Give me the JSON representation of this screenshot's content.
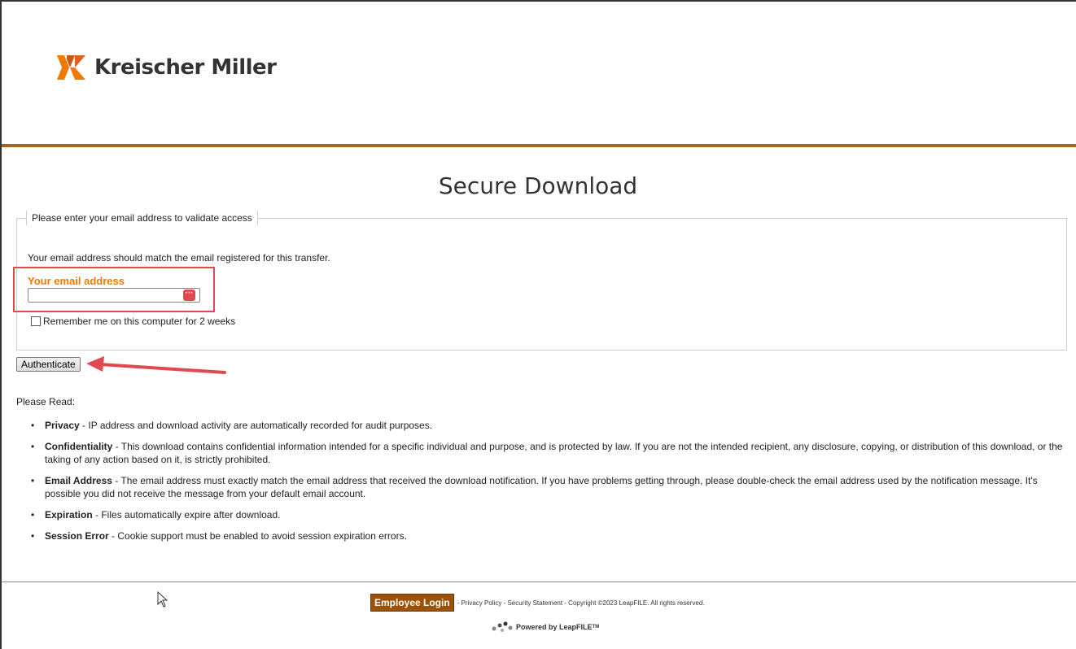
{
  "header": {
    "logo_text": "Kreischer Miller",
    "brand_color": "#a8641a"
  },
  "main": {
    "title": "Secure Download",
    "legend": "Please enter your email address to validate access",
    "intro": "Your email address should match the email registered for this transfer.",
    "email_label": "Your email address",
    "email_value": "",
    "email_placeholder": "",
    "password_manager_icon": "password-manager-icon",
    "remember_label": "Remember me on this computer for 2 weeks",
    "authenticate_label": "Authenticate"
  },
  "notes": {
    "heading": "Please Read:",
    "items": [
      {
        "term": "Privacy",
        "text": " - IP address and download activity are automatically recorded for audit purposes."
      },
      {
        "term": "Confidentiality",
        "text": " - This download contains confidential information intended for a specific individual and purpose, and is protected by law. If you are not the intended recipient, any disclosure, copying, or distribution of this download, or the taking of any action based on it, is strictly prohibited."
      },
      {
        "term": "Email Address",
        "text": " - The email address must exactly match the email address that received the download notification. If you have problems getting through, please double-check the email address used by the notification message. It's possible you did not receive the message from your default email account."
      },
      {
        "term": "Expiration",
        "text": " - Files automatically expire after download."
      },
      {
        "term": "Session Error",
        "text": " - Cookie support must be enabled to avoid session expiration errors."
      }
    ]
  },
  "footer": {
    "employee_login": "Employee Login",
    "links_text": "- Privacy Policy - Security Statement - Copyright ©2023 LeapFILE. All rights reserved.",
    "powered_by": "Powered by LeapFILE",
    "trademark": "TM"
  }
}
